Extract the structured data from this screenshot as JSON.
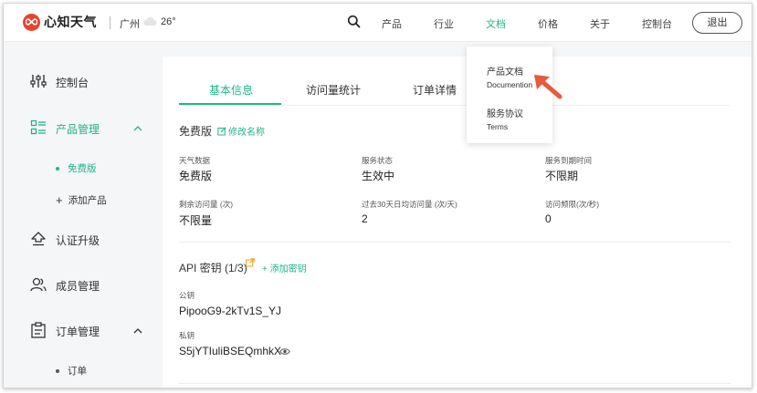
{
  "brand": {
    "name": "心知天气",
    "accent": "#20b589",
    "logo_color": "#e8432f"
  },
  "weather": {
    "city": "广州",
    "icon": "cloud-icon",
    "temperature": "26°"
  },
  "nav": {
    "items": [
      "产品",
      "行业",
      "文档",
      "价格",
      "关于",
      "控制台"
    ],
    "active": "文档",
    "logout": "退出"
  },
  "dropdown": [
    {
      "zh": "产品文档",
      "en": "Documention"
    },
    {
      "zh": "服务协议",
      "en": "Terms"
    }
  ],
  "sidebar": {
    "items": [
      {
        "label": "控制台",
        "icon": "sliders-icon"
      },
      {
        "label": "产品管理",
        "icon": "grid-list-icon"
      },
      {
        "label": "免费版"
      },
      {
        "label": "添加产品"
      },
      {
        "label": "认证升级",
        "icon": "upgrade-icon"
      },
      {
        "label": "成员管理",
        "icon": "users-icon"
      },
      {
        "label": "订单管理",
        "icon": "clipboard-icon"
      },
      {
        "label": "订单"
      }
    ]
  },
  "tabs": [
    "基本信息",
    "访问量统计",
    "订单详情"
  ],
  "plan": {
    "name": "免费版",
    "edit": "修改名称"
  },
  "fields": [
    {
      "label": "天气数据",
      "value": "免费版"
    },
    {
      "label": "服务状态",
      "value": "生效中"
    },
    {
      "label": "服务到期时间",
      "value": "不限期"
    },
    {
      "label": "剩余访问量 (次)",
      "value": "不限量"
    },
    {
      "label": "过去30天日均访问量 (次/天)",
      "value": "2"
    },
    {
      "label": "访问频限(次/秒)",
      "value": "0"
    }
  ],
  "api": {
    "title": "API 密钥 (1/3)",
    "add": "添加密钥",
    "public_label": "公钥",
    "public_key": "PipooG9-2kTv1S_YJ",
    "private_label": "私钥",
    "private_key": "S5jYTIuliBSEQmhkX"
  }
}
